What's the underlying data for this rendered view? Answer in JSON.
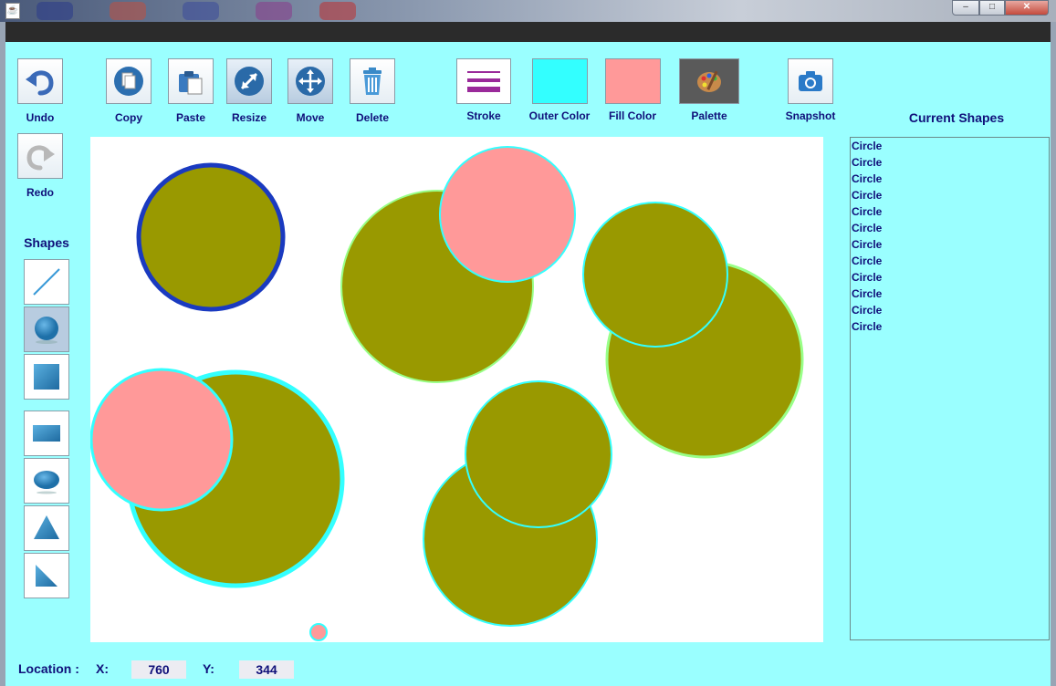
{
  "window": {
    "icon": "java-cup-icon",
    "controls": {
      "minimize": "–",
      "maximize": "□",
      "close": "✕"
    }
  },
  "toolbar": {
    "undo": "Undo",
    "redo": "Redo",
    "copy": "Copy",
    "paste": "Paste",
    "resize": "Resize",
    "move": "Move",
    "delete": "Delete",
    "stroke": "Stroke",
    "outer_color": "Outer Color",
    "fill_color": "Fill Color",
    "palette": "Palette",
    "snapshot": "Snapshot"
  },
  "colors": {
    "outer_color": "#33ffff",
    "fill_color": "#ff9999",
    "shape_fill": "#999900",
    "app_background": "#9affff",
    "label_text": "#10107a"
  },
  "shapes_label": "Shapes",
  "shape_tools": [
    "line",
    "circle",
    "square",
    "rectangle",
    "ellipse",
    "triangle",
    "right-triangle"
  ],
  "selected_tool": "circle",
  "current_shapes": {
    "title": "Current Shapes",
    "items": [
      "Circle",
      "Circle",
      "Circle",
      "Circle",
      "Circle",
      "Circle",
      "Circle",
      "Circle",
      "Circle",
      "Circle",
      "Circle",
      "Circle"
    ]
  },
  "status": {
    "location_label": "Location :",
    "x_label": "X:",
    "x_value": "760",
    "y_label": "Y:",
    "y_value": "344"
  }
}
